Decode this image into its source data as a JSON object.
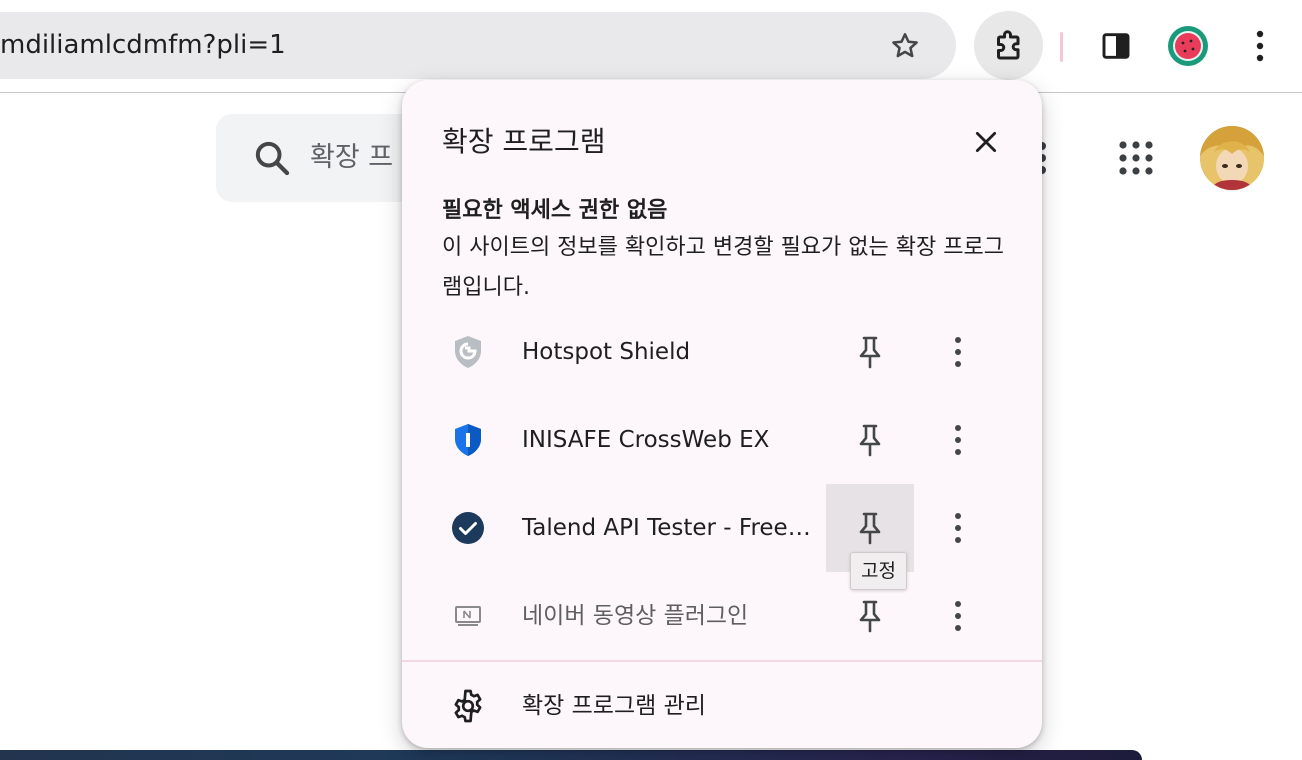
{
  "toolbar": {
    "url": "mdiliamlcdmfm?pli=1"
  },
  "page": {
    "search_placeholder": "확장 프"
  },
  "popup": {
    "title": "확장 프로그램",
    "section_heading": "필요한 액세스 권한 없음",
    "section_desc": "이 사이트의 정보를 확인하고 변경할 필요가 없는 확장 프로그램입니다.",
    "extensions": [
      {
        "name": "Hotspot Shield",
        "icon": "shield-icon",
        "pinned_hover": false,
        "dim": false
      },
      {
        "name": "INISAFE CrossWeb EX",
        "icon": "inisafe-shield-icon",
        "pinned_hover": false,
        "dim": false
      },
      {
        "name": "Talend API Tester - Free Edition",
        "icon": "check-circle-icon",
        "pinned_hover": true,
        "dim": false
      },
      {
        "name": "네이버 동영상 플러그인",
        "icon": "naver-tv-icon",
        "pinned_hover": false,
        "dim": true
      }
    ],
    "pin_tooltip": "고정",
    "manage_label": "확장 프로그램 관리"
  },
  "colors": {
    "accent_dark_blue": "#1b3a5c",
    "inisafe_blue": "#1a73e8",
    "popup_bg": "#fdf7fb"
  }
}
